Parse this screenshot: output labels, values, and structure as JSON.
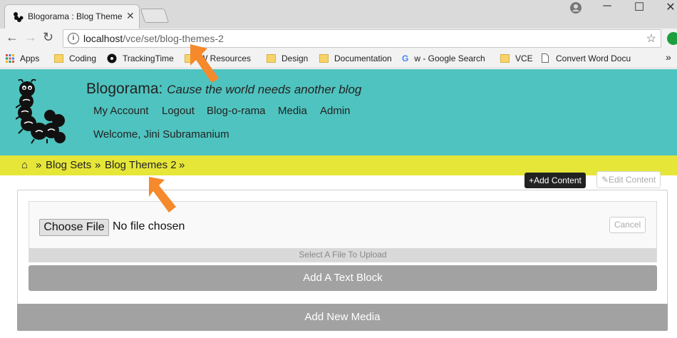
{
  "browser": {
    "tab_title": "Blogorama : Blog Themes",
    "close_glyph": "✕",
    "window_controls": {
      "minimize": "─",
      "maximize": "☐",
      "close": "✕"
    },
    "back_glyph": "←",
    "forward_glyph": "→",
    "reload_glyph": "↻",
    "url_host": "localhost",
    "url_path": "/vce/set/blog-themes-2",
    "star_glyph": "☆",
    "bookmarks": [
      "Apps",
      "Coding",
      "TrackingTime",
      "W Resources",
      "Design",
      "Documentation",
      "w - Google Search",
      "VCE",
      "Convert Word Docu"
    ],
    "bookmarks_more": "»"
  },
  "site": {
    "name": "Blogorama:",
    "tagline": "Cause the world needs another blog",
    "nav": [
      "My Account",
      "Logout",
      "Blog-o-rama",
      "Media",
      "Admin"
    ],
    "welcome": "Welcome, Jini Subramanium"
  },
  "breadcrumb": {
    "home_glyph": "⌂",
    "separator": "»",
    "items": [
      "Blog Sets",
      "Blog Themes 2"
    ]
  },
  "toolbar": {
    "add_content": "+Add Content",
    "edit_content": "✎Edit Content"
  },
  "upload": {
    "choose_file": "Choose File",
    "no_file": "No file chosen",
    "cancel": "Cancel",
    "hint": "Select A File To Upload"
  },
  "actions": {
    "add_text_block": "Add A Text Block",
    "add_new_media": "Add New Media"
  },
  "colors": {
    "header": "#4fc3bf",
    "breadcrumb": "#e6e639",
    "button_gray": "#a2a2a2",
    "arrow": "#f5892b"
  }
}
